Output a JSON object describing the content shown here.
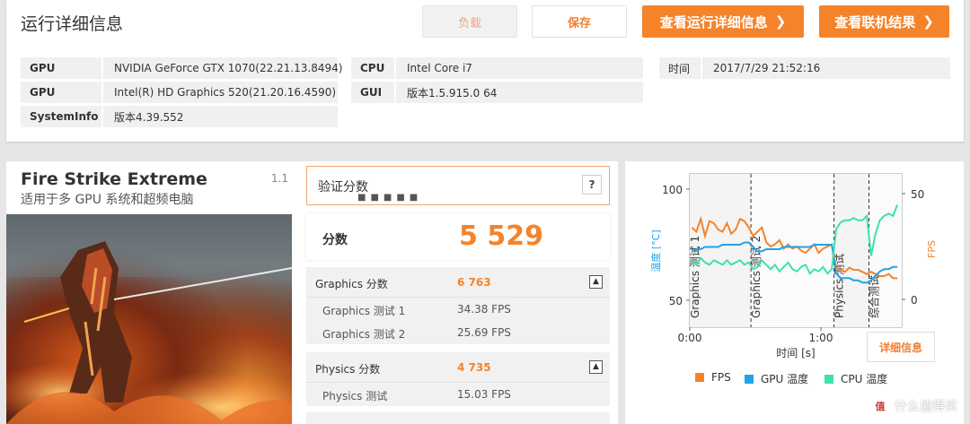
{
  "header": {
    "title": "运行详细信息",
    "load_label": "负载",
    "save_label": "保存",
    "details_label": "查看运行详细信息",
    "online_label": "查看联机结果"
  },
  "system_info": {
    "rows": [
      {
        "label": "GPU",
        "value": "NVIDIA GeForce GTX 1070(22.21.13.8494)"
      },
      {
        "label": "GPU",
        "value": "Intel(R) HD Graphics 520(21.20.16.4590)"
      },
      {
        "label": "SystemInfo",
        "value": "版本4.39.552"
      },
      {
        "label": "CPU",
        "value": "Intel Core i7"
      },
      {
        "label": "GUI",
        "value": "版本1.5.915.0 64"
      },
      {
        "label": "时间",
        "value": "2017/7/29 21:52:16"
      }
    ]
  },
  "test": {
    "name": "Fire Strike Extreme",
    "version": "1.1",
    "subtitle": "适用于多 GPU 系统和超频电脑"
  },
  "score": {
    "verify_label": "验证分数",
    "verify_dots": "■■■■■",
    "help_label": "?",
    "total_label": "分数",
    "total_value": "5 529",
    "sections": [
      {
        "label": "Graphics 分数",
        "value": "6 763",
        "items": [
          {
            "label": "Graphics 测试 1",
            "value": "34.38 FPS"
          },
          {
            "label": "Graphics 测试 2",
            "value": "25.69 FPS"
          }
        ]
      },
      {
        "label": "Physics 分数",
        "value": "4 735",
        "items": [
          {
            "label": "Physics 测试",
            "value": "15.03 FPS"
          }
        ]
      }
    ]
  },
  "chart": {
    "details_label": "详细信息",
    "legend": [
      {
        "name": "FPS",
        "color": "#f5832a"
      },
      {
        "name": "GPU 温度",
        "color": "#1ea4e9"
      },
      {
        "name": "CPU 温度",
        "color": "#3de2a8"
      }
    ]
  },
  "chart_data": {
    "type": "line",
    "xlabel": "时间 [s]",
    "ylabel_left": "温度 [°C]",
    "ylabel_right": "FPS",
    "x_ticks": [
      "0:00",
      "1:00"
    ],
    "y_left_ticks": [
      100,
      50
    ],
    "y_right_ticks": [
      50,
      0
    ],
    "ylim_left": [
      50,
      100
    ],
    "ylim_right": [
      0,
      50
    ],
    "xlim_seconds": [
      0,
      97
    ],
    "phases": [
      {
        "name": "Graphics 测试 1",
        "start": 0,
        "end": 28
      },
      {
        "name": "Graphics 测试 2",
        "start": 28,
        "end": 66
      },
      {
        "name": "Physics 测试",
        "start": 66,
        "end": 82
      },
      {
        "name": "综合测试",
        "start": 82,
        "end": 97
      }
    ],
    "series": [
      {
        "name": "FPS",
        "color": "#f5832a",
        "x": [
          1,
          3,
          5,
          7,
          9,
          11,
          13,
          15,
          17,
          19,
          21,
          23,
          25,
          27,
          29,
          31,
          33,
          35,
          37,
          39,
          41,
          43,
          45,
          47,
          49,
          51,
          53,
          55,
          57,
          59,
          61,
          63,
          65,
          67,
          69,
          71,
          73,
          75,
          77,
          79,
          81,
          83,
          85,
          87,
          89,
          91,
          93,
          95
        ],
        "values": [
          34,
          32,
          38,
          30,
          37,
          36,
          33,
          32,
          36,
          31,
          33,
          38,
          37,
          34,
          30,
          32,
          34,
          27,
          25,
          26,
          28,
          24,
          26,
          24,
          25,
          23,
          22,
          24,
          26,
          22,
          24,
          25,
          26,
          15,
          14,
          13,
          15,
          14,
          14,
          13,
          12,
          13,
          12,
          11,
          11,
          12,
          10,
          10
        ]
      },
      {
        "name": "GPU 温度",
        "color": "#1ea4e9",
        "x": [
          1,
          3,
          5,
          7,
          9,
          11,
          13,
          15,
          17,
          19,
          21,
          23,
          25,
          27,
          29,
          31,
          33,
          35,
          37,
          39,
          41,
          43,
          45,
          47,
          49,
          51,
          53,
          55,
          57,
          59,
          61,
          63,
          65,
          67,
          69,
          71,
          73,
          75,
          77,
          79,
          81,
          83,
          85,
          87,
          89,
          91,
          93,
          95
        ],
        "values": [
          72,
          73,
          73,
          74,
          74,
          74,
          74,
          75,
          75,
          75,
          75,
          75,
          76,
          76,
          74,
          72,
          72,
          73,
          73,
          73,
          73,
          74,
          74,
          74,
          74,
          74,
          74,
          74,
          75,
          75,
          75,
          75,
          75,
          62,
          60,
          60,
          60,
          59,
          59,
          58,
          58,
          59,
          61,
          63,
          64,
          64,
          65,
          65
        ]
      },
      {
        "name": "CPU 温度",
        "color": "#3de2a8",
        "x": [
          1,
          3,
          5,
          7,
          9,
          11,
          13,
          15,
          17,
          19,
          21,
          23,
          25,
          27,
          29,
          31,
          33,
          35,
          37,
          39,
          41,
          43,
          45,
          47,
          49,
          51,
          53,
          55,
          57,
          59,
          61,
          63,
          65,
          67,
          69,
          71,
          73,
          75,
          77,
          79,
          81,
          83,
          85,
          87,
          89,
          91,
          93,
          95
        ],
        "values": [
          68,
          66,
          69,
          67,
          66,
          68,
          67,
          66,
          68,
          66,
          67,
          68,
          66,
          67,
          64,
          65,
          68,
          66,
          64,
          66,
          63,
          65,
          67,
          64,
          63,
          65,
          66,
          62,
          64,
          63,
          65,
          62,
          64,
          82,
          85,
          86,
          86,
          87,
          86,
          86,
          88,
          70,
          80,
          86,
          88,
          89,
          88,
          93
        ]
      }
    ]
  },
  "watermark": {
    "logo": "值",
    "text": "什么值得买"
  }
}
